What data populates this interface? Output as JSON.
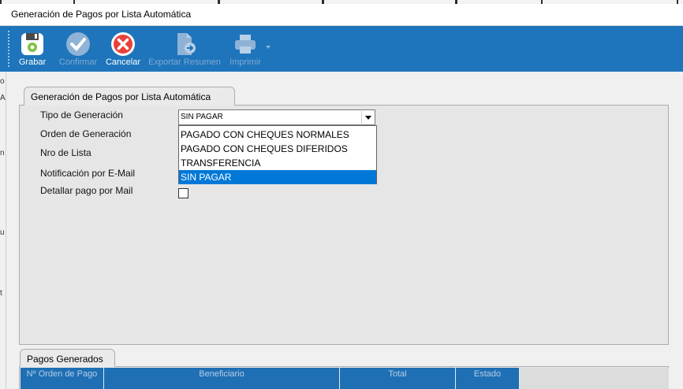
{
  "window": {
    "title": "Generación de Pagos por Lista Automática"
  },
  "toolbar": {
    "buttons": [
      {
        "label": "Grabar",
        "icon": "save-icon",
        "enabled": true
      },
      {
        "label": "Confirmar",
        "icon": "check-circle-icon",
        "enabled": false
      },
      {
        "label": "Cancelar",
        "icon": "cancel-circle-icon",
        "enabled": true
      },
      {
        "label": "Exportar Resumen",
        "icon": "export-document-icon",
        "enabled": false
      },
      {
        "label": "Imprimir",
        "icon": "printer-icon",
        "enabled": false
      }
    ]
  },
  "left_edge": {
    "fragments": [
      "o",
      "A",
      "n",
      "u",
      "t"
    ]
  },
  "form": {
    "tab_label": "Generación de Pagos por Lista Automática",
    "fields": {
      "tipo_generacion": {
        "label": "Tipo de Generación",
        "value": "SIN PAGAR"
      },
      "orden_generacion": {
        "label": "Orden de Generación"
      },
      "nro_lista": {
        "label": "Nro de Lista"
      },
      "notificacion_email": {
        "label": "Notificación por E-Mail"
      },
      "detallar_pago": {
        "label": "Detallar pago por Mail",
        "checked": false
      }
    },
    "dropdown_options": [
      "PAGADO CON CHEQUES NORMALES",
      "PAGADO CON CHEQUES DIFERIDOS",
      "TRANSFERENCIA",
      "SIN PAGAR"
    ],
    "selected_index": 3
  },
  "pagos": {
    "tab_label": "Pagos Generados",
    "columns": [
      "Nº Orden de Pago",
      "Beneficiario",
      "Total",
      "Estado"
    ]
  },
  "colors": {
    "toolbar": "#1e75bb",
    "selection": "#0078d7",
    "grid_header": "#1f6fb4"
  }
}
